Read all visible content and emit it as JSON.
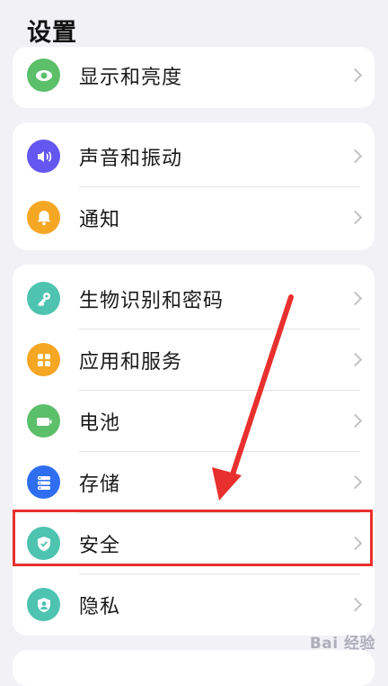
{
  "header": {
    "title": "设置"
  },
  "colors": {
    "highlight": "#e8302e",
    "arrow": "#e8302e"
  },
  "groups": [
    {
      "items": [
        {
          "label": "显示和亮度",
          "icon": "eye-icon",
          "color": "#5cbf6a"
        }
      ]
    },
    {
      "items": [
        {
          "label": "声音和振动",
          "icon": "sound-icon",
          "color": "#6456f0"
        },
        {
          "label": "通知",
          "icon": "bell-icon",
          "color": "#f5a623"
        }
      ]
    },
    {
      "items": [
        {
          "label": "生物识别和密码",
          "icon": "key-icon",
          "color": "#4dc3b0"
        },
        {
          "label": "应用和服务",
          "icon": "apps-icon",
          "color": "#f5a623"
        },
        {
          "label": "电池",
          "icon": "battery-icon",
          "color": "#5cbf6a"
        },
        {
          "label": "存储",
          "icon": "storage-icon",
          "color": "#2f6ef0"
        },
        {
          "label": "安全",
          "icon": "shield-icon",
          "color": "#4dc3b0"
        },
        {
          "label": "隐私",
          "icon": "privacy-icon",
          "color": "#4dc3b0"
        }
      ]
    }
  ],
  "watermark": "Bai 经验"
}
